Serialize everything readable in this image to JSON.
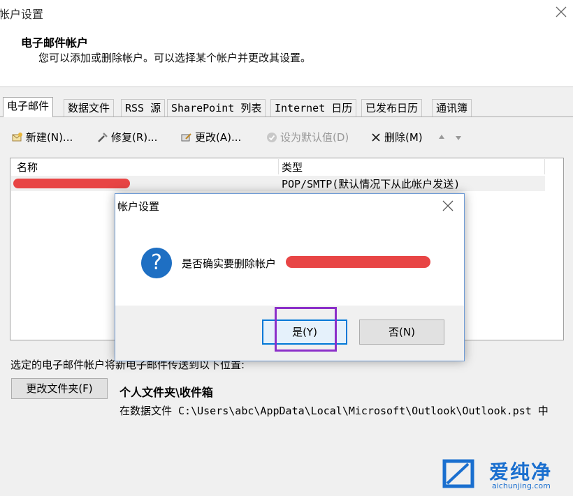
{
  "window": {
    "title": "帐户设置",
    "header_title": "电子邮件帐户",
    "header_desc": "您可以添加或删除帐户。可以选择某个帐户并更改其设置。"
  },
  "tabs": [
    {
      "label": "电子邮件",
      "active": true
    },
    {
      "label": "数据文件"
    },
    {
      "label": "RSS 源"
    },
    {
      "label": "SharePoint 列表"
    },
    {
      "label": "Internet 日历"
    },
    {
      "label": "已发布日历"
    },
    {
      "label": "通讯簿"
    }
  ],
  "toolbar": {
    "new": "新建(N)...",
    "repair": "修复(R)...",
    "change": "更改(A)...",
    "set_default": "设为默认值(D)",
    "delete": "删除(M)"
  },
  "list": {
    "col_name": "名称",
    "col_type": "类型",
    "rows": [
      {
        "type": "POP/SMTP(默认情况下从此帐户发送)"
      }
    ]
  },
  "bottom": {
    "selected_text": "选定的电子邮件帐户将新电子邮件传送到以下位置:",
    "change_folder": "更改文件夹(F)",
    "folder_name": "个人文件夹\\收件箱",
    "folder_path": "在数据文件 C:\\Users\\abc\\AppData\\Local\\Microsoft\\Outlook\\Outlook.pst 中"
  },
  "dialog": {
    "title": "帐户设置",
    "message": "是否确实要删除帐户",
    "yes": "是(Y)",
    "no": "否(N)"
  },
  "watermark": {
    "brand": "爱纯净",
    "url": "aichunjing.com"
  },
  "colors": {
    "accent": "#0078d7",
    "highlight": "#8b2fc9",
    "redaction": "#e84545",
    "icon_blue": "#1e6fc3"
  }
}
